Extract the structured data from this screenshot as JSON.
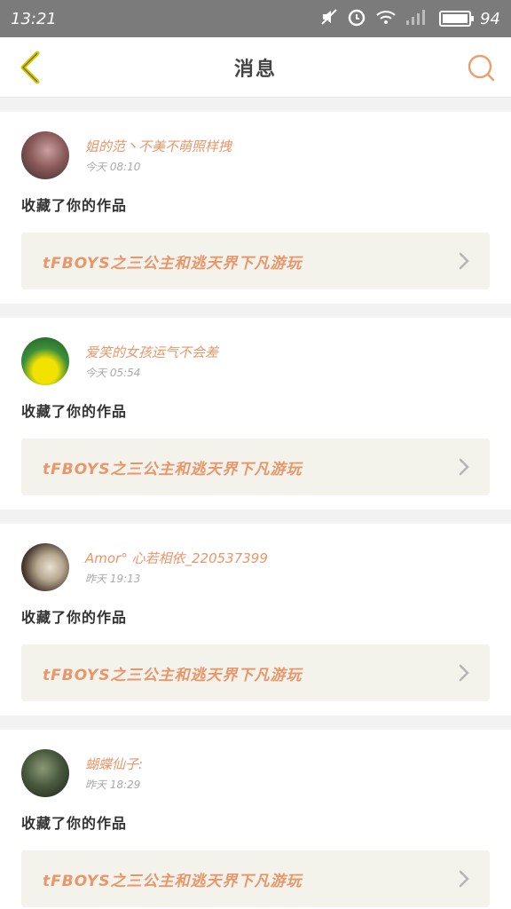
{
  "status_bar": {
    "time": "13:21",
    "battery": "94"
  },
  "header": {
    "title": "消息"
  },
  "accent_color": "#e8966a",
  "messages": [
    {
      "username": "姐的范丶不美不萌照样拽",
      "time": "今天 08:10",
      "action": "收藏了你的作品",
      "work_title": "tFBOYS之三公主和逃天界下凡游玩",
      "avatar_colors": [
        "#6b4a4a",
        "#c9a0a0"
      ]
    },
    {
      "username": "爱笑的女孩运气不会差",
      "time": "今天 05:54",
      "action": "收藏了你的作品",
      "work_title": "tFBOYS之三公主和逃天界下凡游玩",
      "avatar_colors": [
        "#3c8f3c",
        "#f2e200"
      ]
    },
    {
      "username": "Amor° 心若相依_220537399",
      "time": "昨天 19:13",
      "action": "收藏了你的作品",
      "work_title": "tFBOYS之三公主和逃天界下凡游玩",
      "avatar_colors": [
        "#3a2f2a",
        "#d8cfc4"
      ]
    },
    {
      "username": "蝴蝶仙子:",
      "time": "昨天 18:29",
      "action": "收藏了你的作品",
      "work_title": "tFBOYS之三公主和逃天界下凡游玩",
      "avatar_colors": [
        "#1f2a1f",
        "#6b7a5a"
      ]
    }
  ]
}
